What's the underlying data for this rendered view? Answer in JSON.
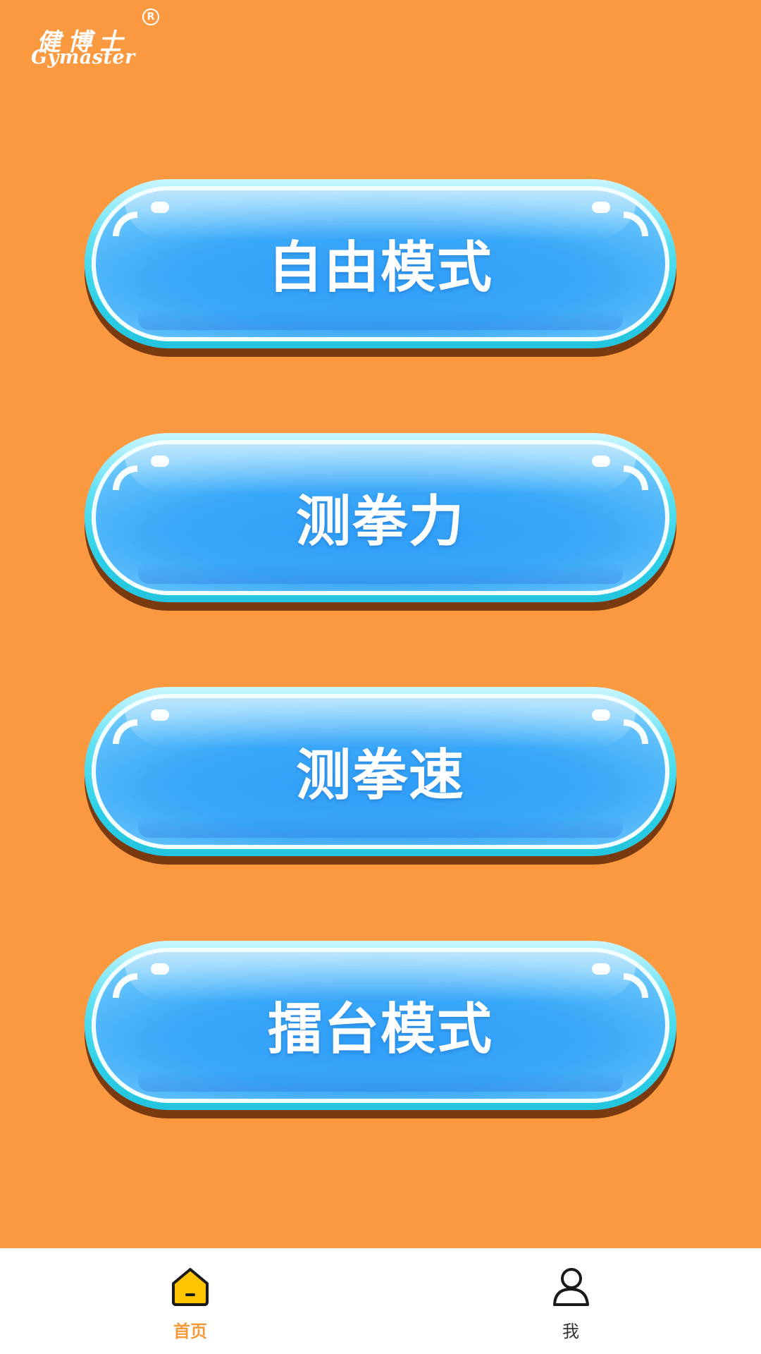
{
  "brand": {
    "name_cn": "健博士",
    "name_en": "Gymaster",
    "registered_mark": "R"
  },
  "modes": [
    {
      "label": "自由模式"
    },
    {
      "label": "测拳力"
    },
    {
      "label": "测拳速"
    },
    {
      "label": "擂台模式"
    }
  ],
  "tabbar": {
    "home_label": "首页",
    "me_label": "我",
    "active": "home"
  },
  "colors": {
    "background": "#FA9940",
    "button_blue": "#2E9CF7",
    "button_rim": "#2BCFE6",
    "active_tab": "#F29A3A",
    "home_icon_fill": "#FFC400"
  },
  "icons": {
    "home": "home-icon",
    "profile": "person-icon"
  }
}
